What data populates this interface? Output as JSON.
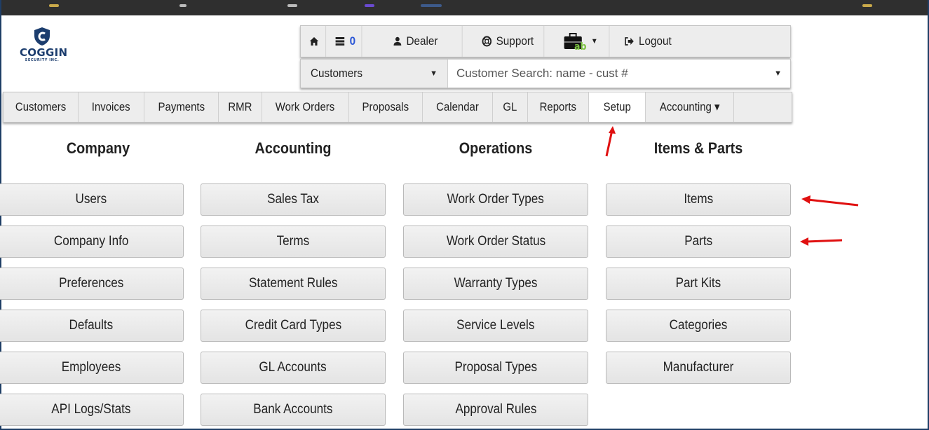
{
  "logo": {
    "brand": "COGGIN",
    "tagline": "SECURITY INC."
  },
  "toolbar": {
    "items": [
      {
        "icon": "home-icon",
        "label": ""
      },
      {
        "icon": "list-icon",
        "label": "",
        "badge": "0"
      },
      {
        "icon": "user-icon",
        "label": "Dealer"
      },
      {
        "icon": "lifebuoy-icon",
        "label": "Support"
      },
      {
        "icon": "briefcase-icon",
        "label": ""
      },
      {
        "icon": "logout-icon",
        "label": "Logout"
      }
    ]
  },
  "search": {
    "scope": "Customers",
    "placeholder": "Customer Search: name - cust #"
  },
  "nav": {
    "items": [
      "Customers",
      "Invoices",
      "Payments",
      "RMR",
      "Work Orders",
      "Proposals",
      "Calendar",
      "GL",
      "Reports",
      "Setup",
      "Accounting ▾"
    ],
    "active": "Setup"
  },
  "columns": [
    {
      "heading": "Company",
      "buttons": [
        "Users",
        "Company Info",
        "Preferences",
        "Defaults",
        "Employees",
        "API Logs/Stats"
      ]
    },
    {
      "heading": "Accounting",
      "buttons": [
        "Sales Tax",
        "Terms",
        "Statement Rules",
        "Credit Card Types",
        "GL Accounts",
        "Bank Accounts"
      ]
    },
    {
      "heading": "Operations",
      "buttons": [
        "Work Order Types",
        "Work Order Status",
        "Warranty Types",
        "Service Levels",
        "Proposal Types",
        "Approval Rules"
      ]
    },
    {
      "heading": "Items & Parts",
      "buttons": [
        "Items",
        "Parts",
        "Part Kits",
        "Categories",
        "Manufacturer"
      ]
    }
  ],
  "colors": {
    "accent_border": "#1f3e66",
    "annotation_arrow": "#e01010",
    "badge": "#2a56d6"
  }
}
